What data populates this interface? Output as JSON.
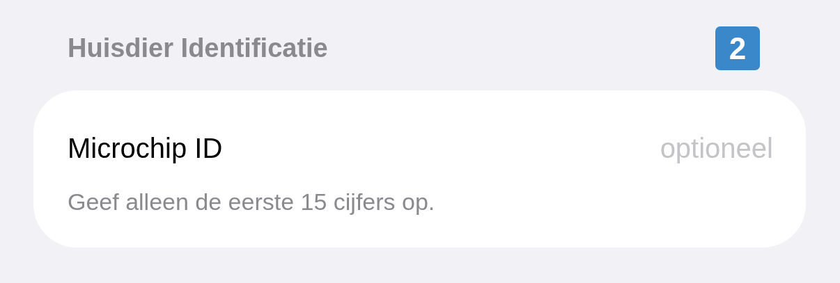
{
  "section": {
    "title": "Huisdier Identificatie",
    "badge": "2"
  },
  "field": {
    "label": "Microchip ID",
    "placeholder": "optioneel",
    "hint": "Geef alleen de eerste 15 cijfers op."
  }
}
